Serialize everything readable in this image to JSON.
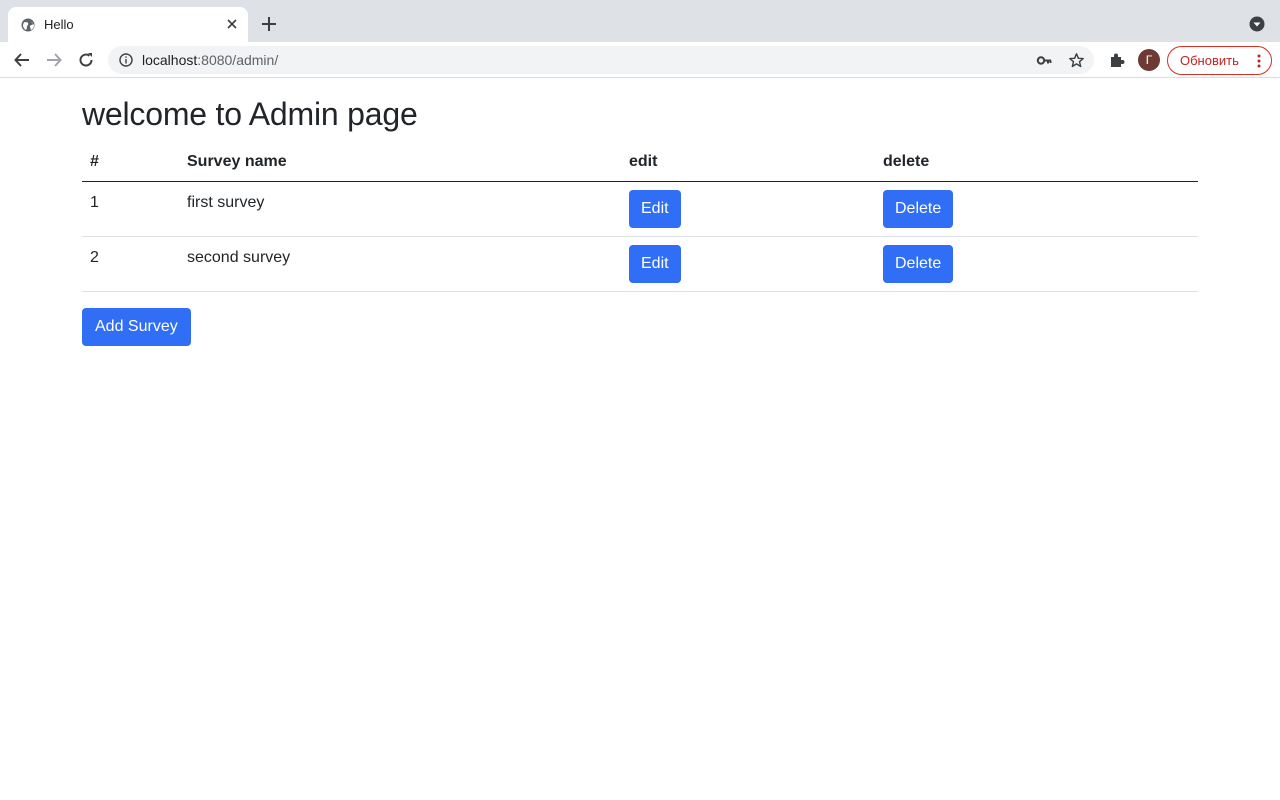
{
  "browser": {
    "tab_title": "Hello",
    "url_host": "localhost",
    "url_rest": ":8080/admin/",
    "profile_initial": "Г",
    "update_label": "Обновить"
  },
  "page": {
    "title": "welcome to Admin page",
    "columns": [
      "#",
      "Survey name",
      "edit",
      "delete"
    ],
    "rows": [
      {
        "num": "1",
        "name": "first survey",
        "edit_label": "Edit",
        "delete_label": "Delete"
      },
      {
        "num": "2",
        "name": "second survey",
        "edit_label": "Edit",
        "delete_label": "Delete"
      }
    ],
    "add_label": "Add Survey"
  },
  "colors": {
    "primary": "#2f6ef5",
    "tabstrip": "#dee1e6",
    "update_red": "#c5221f"
  },
  "icons": [
    "globe-icon",
    "close-icon",
    "plus-icon",
    "tab-search-icon",
    "back-icon",
    "forward-icon",
    "reload-icon",
    "info-icon",
    "key-icon",
    "star-icon",
    "extensions-icon",
    "more-vert-icon"
  ]
}
